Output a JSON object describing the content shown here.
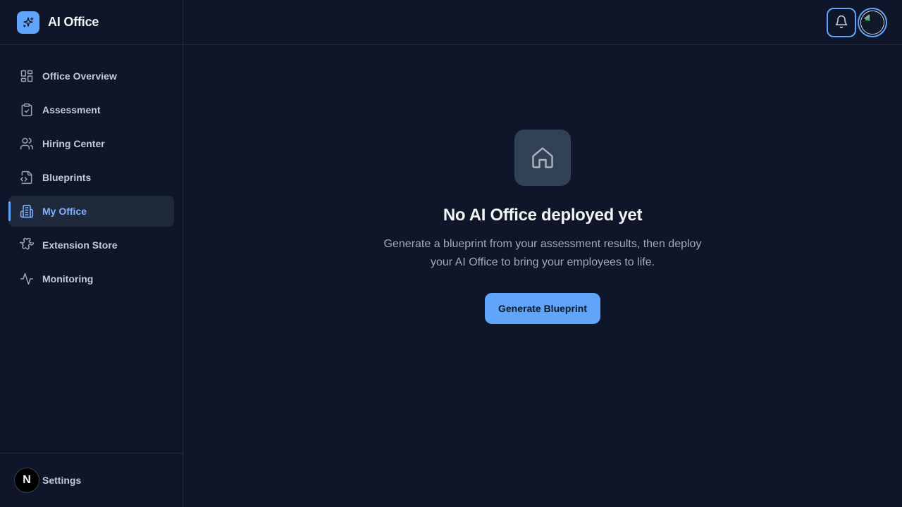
{
  "brand": {
    "name": "AI Office",
    "logo_icon": "sparkles-icon",
    "accent": "#60a5fa"
  },
  "sidebar": {
    "items": [
      {
        "label": "Office Overview",
        "icon": "layout-grid-icon",
        "active": false
      },
      {
        "label": "Assessment",
        "icon": "clipboard-check-icon",
        "active": false
      },
      {
        "label": "Hiring Center",
        "icon": "users-icon",
        "active": false
      },
      {
        "label": "Blueprints",
        "icon": "file-code-icon",
        "active": false
      },
      {
        "label": "My Office",
        "icon": "building-icon",
        "active": true
      },
      {
        "label": "Extension Store",
        "icon": "puzzle-icon",
        "active": false
      },
      {
        "label": "Monitoring",
        "icon": "activity-icon",
        "active": false
      }
    ],
    "footer": {
      "avatar_letter": "N",
      "label": "Settings"
    }
  },
  "topbar": {
    "notifications_icon": "bell-icon",
    "avatar_icon": "user-avatar"
  },
  "empty_state": {
    "icon": "home-icon",
    "title": "No AI Office deployed yet",
    "description": "Generate a blueprint from your assessment results, then deploy your AI Office to bring your employees to life.",
    "button_label": "Generate Blueprint"
  }
}
